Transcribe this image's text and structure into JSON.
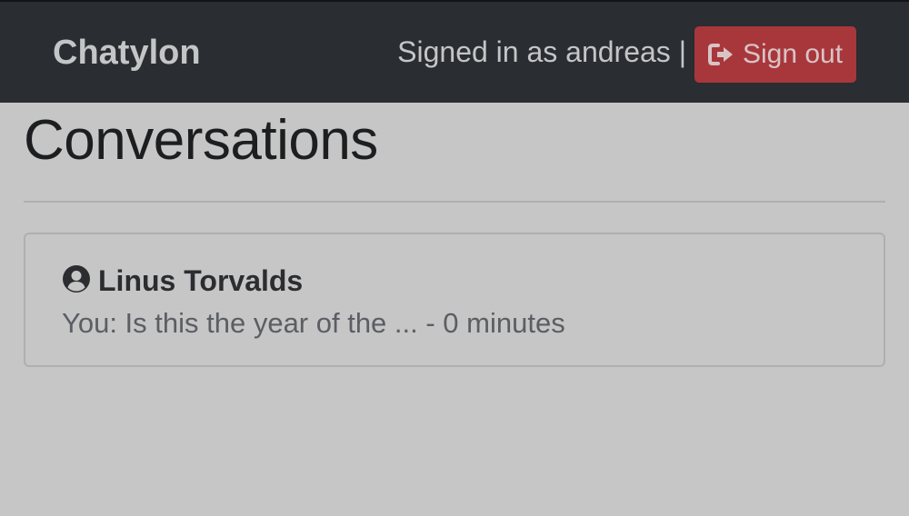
{
  "navbar": {
    "brand": "Chatylon",
    "signed_in_text": "Signed in as andreas |",
    "sign_out_label": "Sign out",
    "sign_out_icon": "sign-out-icon"
  },
  "main": {
    "title": "Conversations",
    "conversations": [
      {
        "contact_icon": "user-circle-icon",
        "contact_name": "Linus Torvalds",
        "preview": "You: Is this the year of the ... - 0 minutes"
      }
    ]
  },
  "colors": {
    "navbar_bg": "#2a2d31",
    "danger": "#a8373c",
    "page_bg": "#c6c6c6"
  }
}
